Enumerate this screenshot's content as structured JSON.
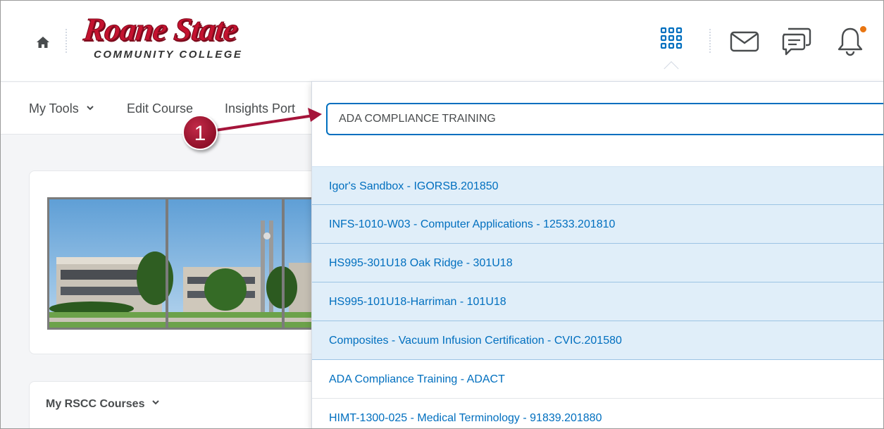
{
  "header": {
    "logo": {
      "main": "Roane State",
      "sub": "COMMUNITY COLLEGE"
    },
    "icons": [
      "home-icon",
      "course-selector-icon",
      "message-icon",
      "chat-icon",
      "notification-bell-icon"
    ],
    "notification_dot_color": "#e87511"
  },
  "nav": {
    "items": [
      {
        "label": "My Tools",
        "has_dropdown": true
      },
      {
        "label": "Edit Course"
      },
      {
        "label": "Insights Port"
      }
    ]
  },
  "callout": {
    "number": "1",
    "color": "#a5143a"
  },
  "course_selector": {
    "search_value": "ADA COMPLIANCE TRAINING",
    "results": [
      {
        "label": "Igor's Sandbox - IGORSB.201850",
        "highlighted": true
      },
      {
        "label": "INFS-1010-W03 - Computer Applications - 12533.201810",
        "highlighted": true
      },
      {
        "label": "HS995-301U18 Oak Ridge - 301U18",
        "highlighted": true
      },
      {
        "label": "HS995-101U18-Harriman - 101U18",
        "highlighted": true
      },
      {
        "label": "Composites - Vacuum Infusion Certification - CVIC.201580",
        "highlighted": true
      },
      {
        "label": "ADA Compliance Training - ADACT",
        "highlighted": false
      },
      {
        "label": "HIMT-1300-025 - Medical Terminology - 91839.201880",
        "highlighted": false
      }
    ]
  },
  "widgets": {
    "courses_label": "My RSCC Courses"
  },
  "colors": {
    "link": "#006fbf",
    "highlight_bg": "#e0eef9",
    "brand_red": "#c4122f"
  }
}
